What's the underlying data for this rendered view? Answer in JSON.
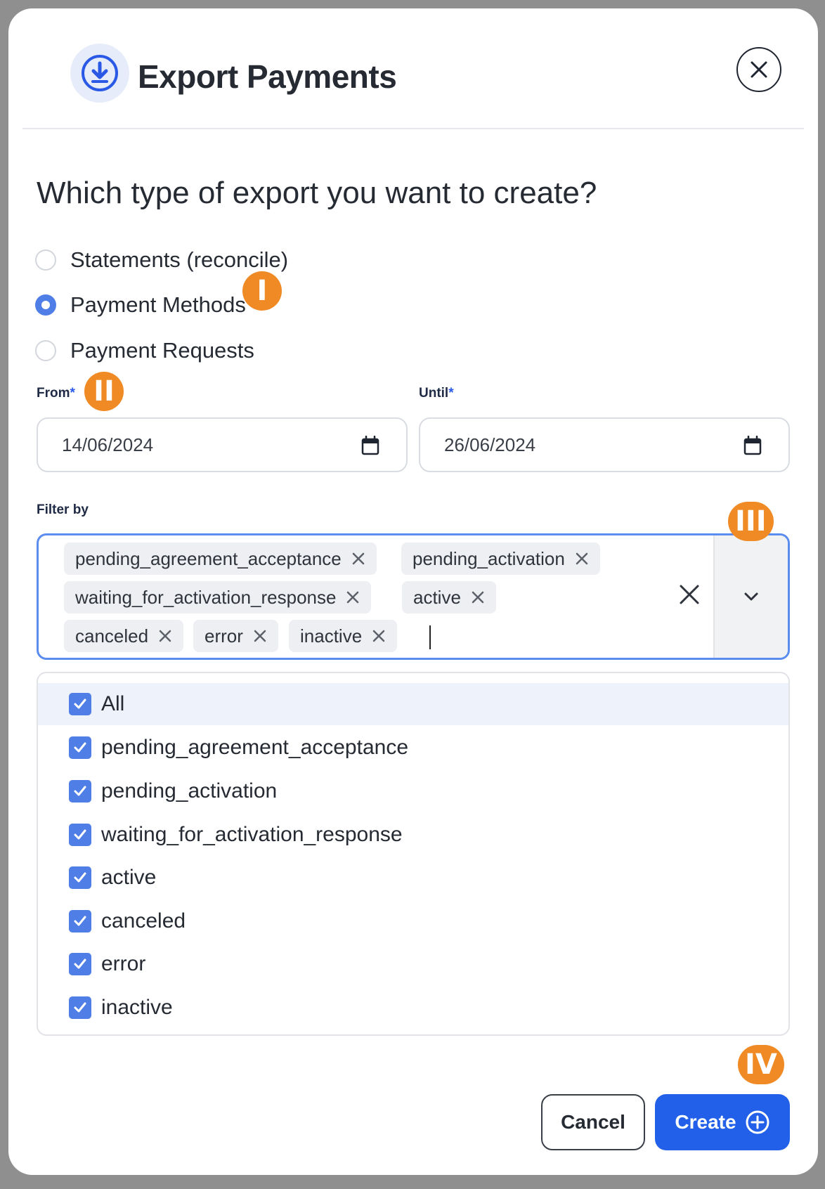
{
  "dialog": {
    "title": "Export Payments",
    "icon": "download-icon",
    "close_icon": "close-icon"
  },
  "question": "Which type of export you want to create?",
  "export_types": [
    {
      "label": "Statements (reconcile)",
      "selected": false
    },
    {
      "label": "Payment Methods",
      "selected": true
    },
    {
      "label": "Payment Requests",
      "selected": false
    }
  ],
  "from": {
    "label": "From",
    "required_mark": "*",
    "value": "14/06/2024"
  },
  "until": {
    "label": "Until",
    "required_mark": "*",
    "value": "26/06/2024"
  },
  "filter": {
    "label": "Filter by",
    "chips": [
      "pending_agreement_acceptance",
      "pending_activation",
      "waiting_for_activation_response",
      "active",
      "canceled",
      "error",
      "inactive"
    ],
    "options": [
      "All",
      "pending_agreement_acceptance",
      "pending_activation",
      "waiting_for_activation_response",
      "active",
      "canceled",
      "error",
      "inactive"
    ]
  },
  "badges": [
    "I",
    "II",
    "III",
    "IV"
  ],
  "buttons": {
    "cancel": "Cancel",
    "create": "Create"
  },
  "colors": {
    "primary": "#2360ea",
    "accent": "#4f7ee6",
    "badge": "#f08a24",
    "focus_border": "#5b8cf0"
  }
}
